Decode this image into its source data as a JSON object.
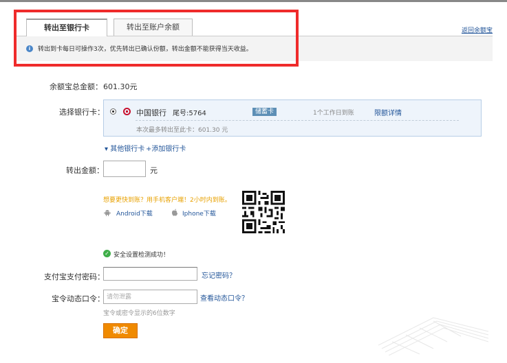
{
  "header": {
    "tabs": [
      {
        "label": "转出至银行卡",
        "active": true
      },
      {
        "label": "转出至账户余额",
        "active": false
      }
    ],
    "return_link": "返回余额宝",
    "notice": "转出到卡每日可操作3次，优先转出已确认份额，转出金额不能获得当天收益。"
  },
  "balance": {
    "label": "余额宝总金额：",
    "value": "601.30元"
  },
  "bank_card": {
    "label": "选择银行卡：",
    "bank_name": "中国银行",
    "tail_number": "尾号:5764",
    "card_type": "储蓄卡",
    "arrival": "1个工作日到账",
    "limit_link": "限额详情",
    "max_transfer": "本次最多转出至此卡：601.30 元"
  },
  "card_links": {
    "other_cards": "▾ 其他银行卡",
    "add_card": "+添加银行卡"
  },
  "amount": {
    "label": "转出金额：",
    "value": "",
    "unit": "元"
  },
  "mobile": {
    "promo": "想要更快到账？用手机客户端！2小时内到账。",
    "android": "Android下载",
    "iphone": "Iphone下载"
  },
  "security": {
    "text": "安全设置检测成功！"
  },
  "password": {
    "label": "支付宝支付密码：",
    "forgot": "忘记密码？"
  },
  "otp": {
    "label": "宝令动态口令：",
    "placeholder": "请勿泄露",
    "view_link": "查看动态口令？",
    "hint": "宝令或密令显示的6位数字"
  },
  "submit": {
    "label": "确定"
  },
  "colors": {
    "link": "#225599",
    "accent_orange": "#f08a00",
    "highlight_red": "#ef2b2b",
    "promo_yellow": "#e8a100"
  }
}
